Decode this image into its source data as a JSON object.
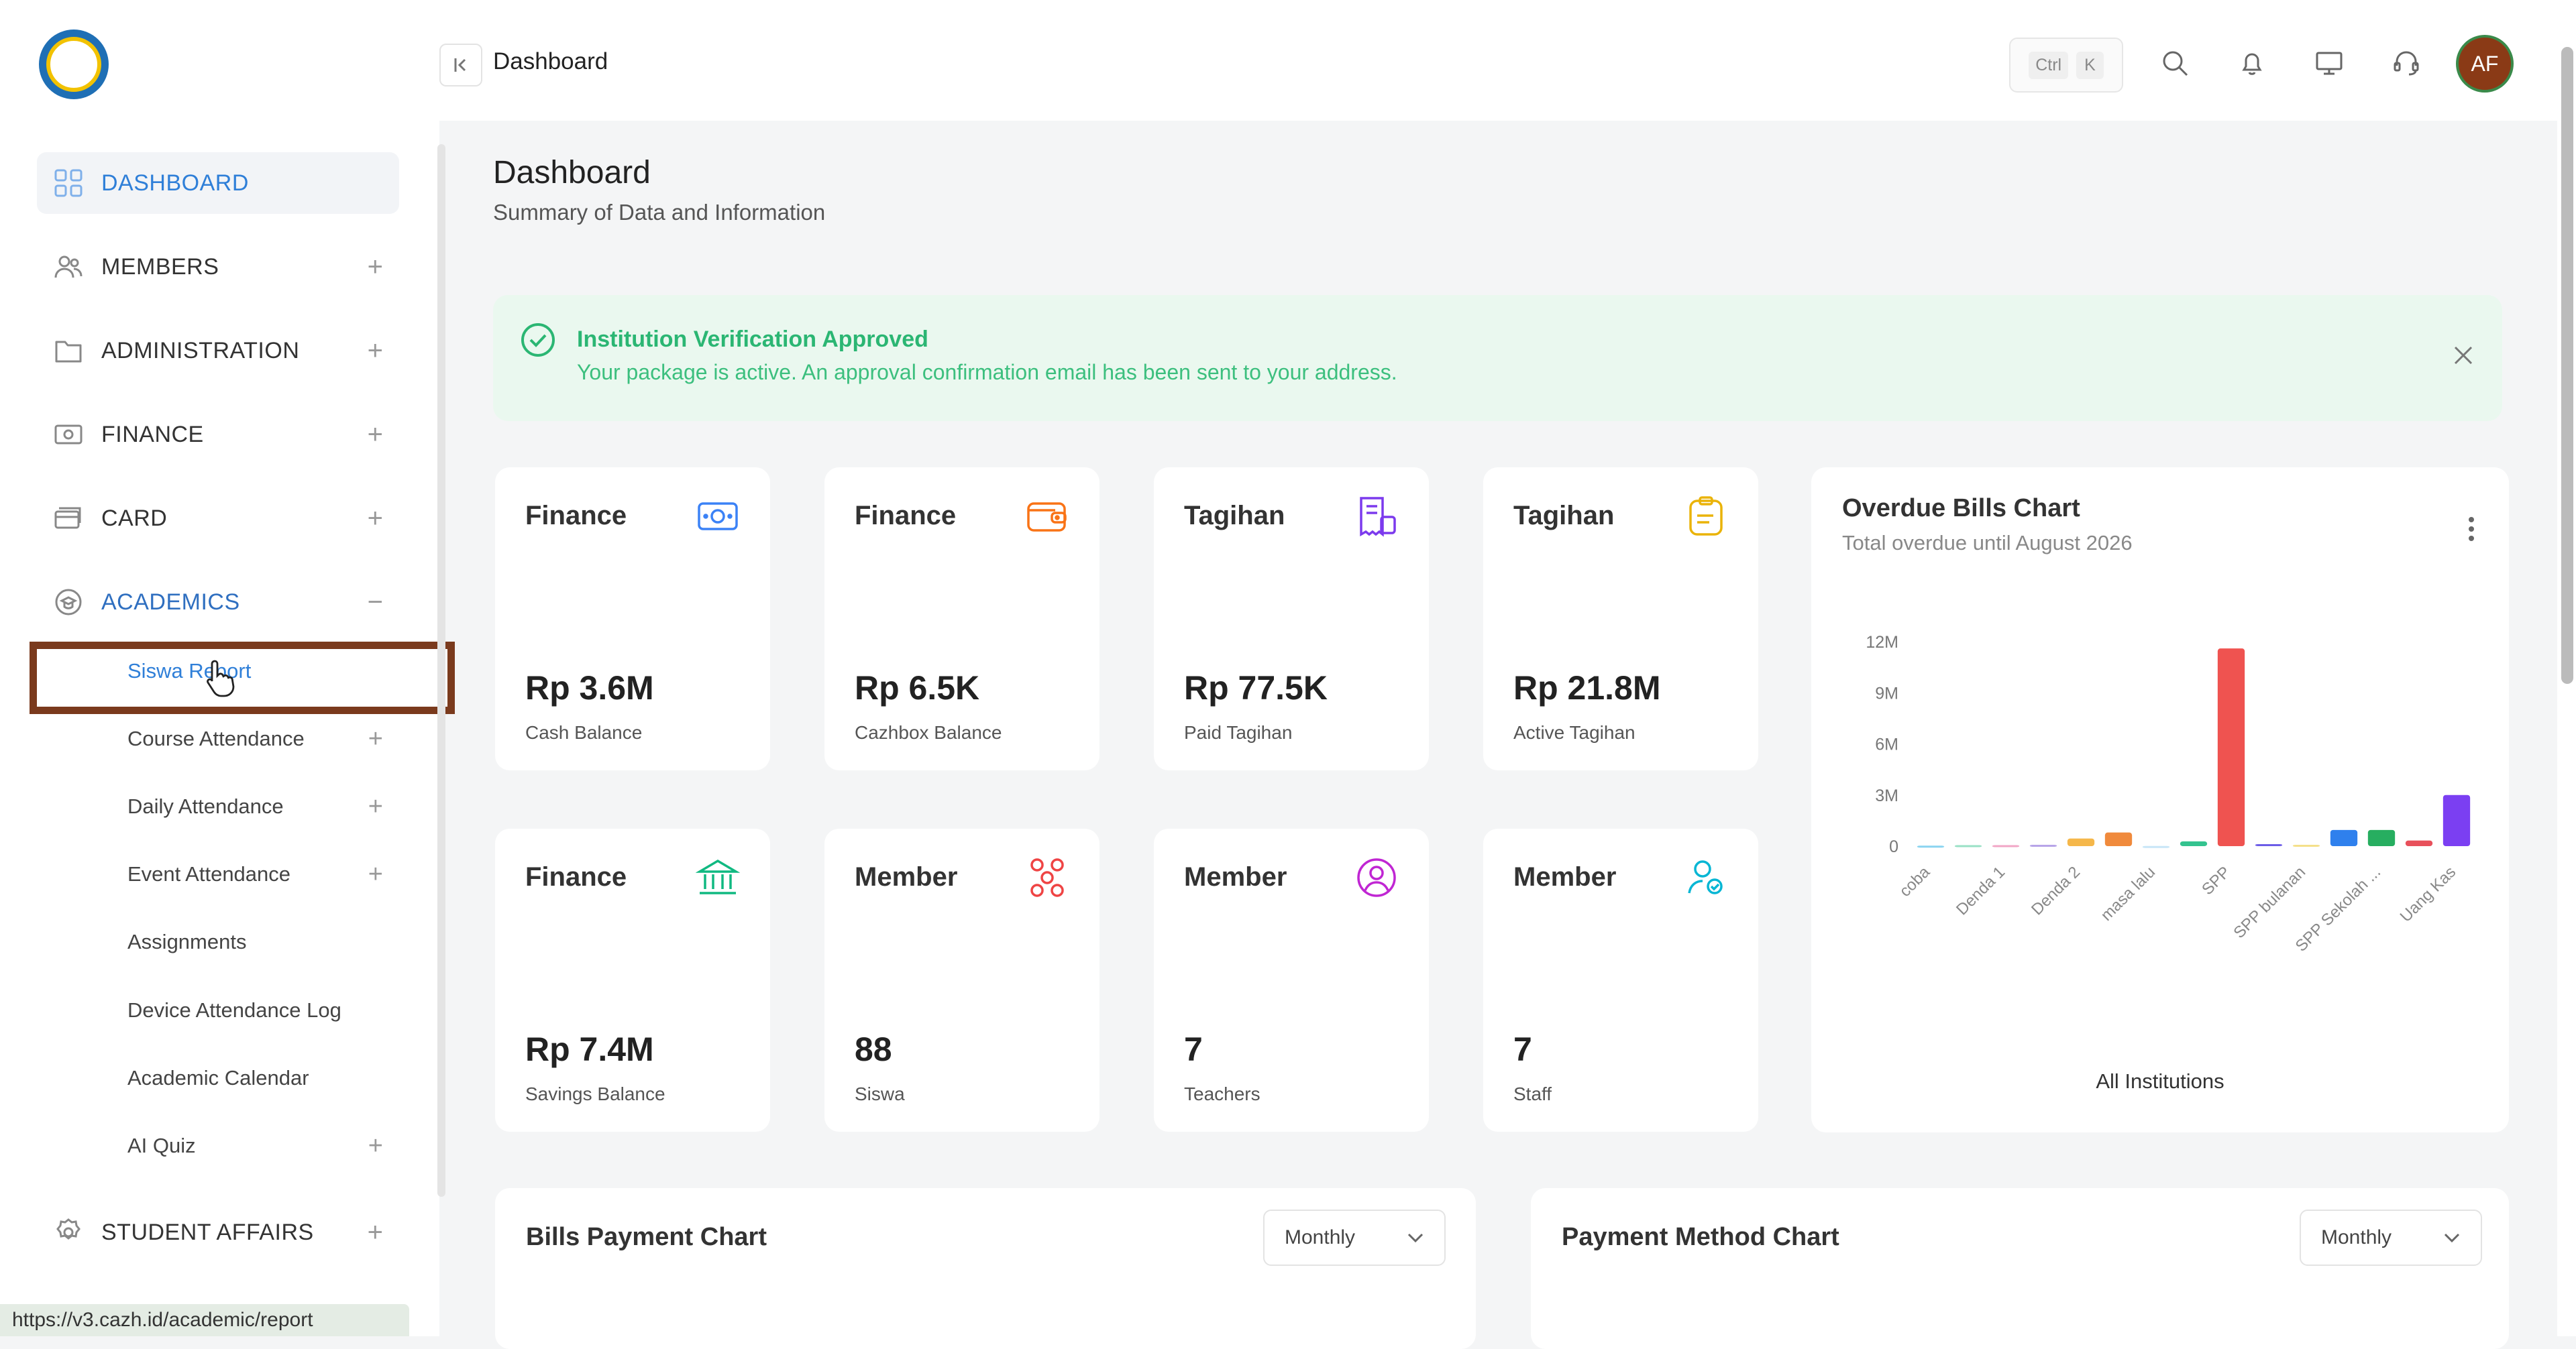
{
  "sidebar": {
    "nav": [
      {
        "label": "DASHBOARD",
        "icon": "grid-icon"
      },
      {
        "label": "MEMBERS",
        "icon": "users-icon"
      },
      {
        "label": "ADMINISTRATION",
        "icon": "folder-icon"
      },
      {
        "label": "FINANCE",
        "icon": "money-icon"
      },
      {
        "label": "CARD",
        "icon": "card-icon"
      },
      {
        "label": "ACADEMICS",
        "icon": "academics-icon"
      },
      {
        "label": "STUDENT AFFAIRS",
        "icon": "badge-icon"
      }
    ],
    "academics_sub": [
      "Siswa Report",
      "Course Attendance",
      "Daily Attendance",
      "Event Attendance",
      "Assignments",
      "Device Attendance Log",
      "Academic Calendar",
      "AI Quiz"
    ],
    "expand_symbol": "+",
    "collapse_symbol": "−"
  },
  "topbar": {
    "breadcrumb": "Dashboard",
    "shortcut_ctrl": "Ctrl",
    "shortcut_key": "K",
    "avatar_initials": "AF"
  },
  "header": {
    "title": "Dashboard",
    "subtitle": "Summary of Data and Information"
  },
  "alert": {
    "title": "Institution Verification Approved",
    "message": "Your package is active. An approval confirmation email has been sent to your address."
  },
  "stats": [
    {
      "title": "Finance",
      "value": "Rp 3.6M",
      "label": "Cash Balance",
      "icon": "cash-icon",
      "color": "#3b82f6"
    },
    {
      "title": "Finance",
      "value": "Rp 6.5K",
      "label": "Cazhbox Balance",
      "icon": "wallet-icon",
      "color": "#f97316"
    },
    {
      "title": "Tagihan",
      "value": "Rp 77.5K",
      "label": "Paid Tagihan",
      "icon": "receipt-icon",
      "color": "#7c3aed"
    },
    {
      "title": "Tagihan",
      "value": "Rp 21.8M",
      "label": "Active Tagihan",
      "icon": "clipboard-icon",
      "color": "#eab308"
    },
    {
      "title": "Finance",
      "value": "Rp 7.4M",
      "label": "Savings Balance",
      "icon": "bank-icon",
      "color": "#10b981"
    },
    {
      "title": "Member",
      "value": "88",
      "label": "Siswa",
      "icon": "group-icon",
      "color": "#ef4444"
    },
    {
      "title": "Member",
      "value": "7",
      "label": "Teachers",
      "icon": "user-circle-icon",
      "color": "#c026d3"
    },
    {
      "title": "Member",
      "value": "7",
      "label": "Staff",
      "icon": "staff-icon",
      "color": "#06b6d4"
    }
  ],
  "overdue": {
    "title": "Overdue Bills Chart",
    "subtitle": "Total overdue until August 2026",
    "footer": "All Institutions"
  },
  "chart_data": {
    "type": "bar",
    "title": "Overdue Bills Chart",
    "subtitle": "Total overdue until August 2026",
    "xlabel": "All Institutions",
    "ylabel": "",
    "ylim": [
      0,
      12000000
    ],
    "yticks": [
      0,
      3000000,
      6000000,
      9000000,
      12000000
    ],
    "ytick_labels": [
      "0",
      "3M",
      "6M",
      "9M",
      "12M"
    ],
    "categories": [
      "coba",
      "",
      "Denda 1",
      "",
      "Denda 2",
      "",
      "masa lalu",
      "",
      "SPP",
      "",
      "SPP bulanan",
      "",
      "SPP Sekolah ...",
      "",
      "Uang Kas"
    ],
    "values": [
      30000,
      60000,
      60000,
      80000,
      450000,
      800000,
      10000,
      280000,
      11600000,
      120000,
      80000,
      950000,
      950000,
      330000,
      3000000
    ],
    "colors": [
      "#8ad4f0",
      "#99e0c5",
      "#f2a6c6",
      "#b7a4e8",
      "#f5b74a",
      "#f08a3c",
      "#c8e6f7",
      "#34c38f",
      "#ef5350",
      "#6c5ce7",
      "#f5e08a",
      "#2f80ed",
      "#27ae60",
      "#e8505b",
      "#7b3ff2"
    ]
  },
  "bills_payment": {
    "title": "Bills Payment Chart",
    "period": "Monthly"
  },
  "payment_method": {
    "title": "Payment Method Chart",
    "period": "Monthly"
  },
  "status_url": "https://v3.cazh.id/academic/report"
}
